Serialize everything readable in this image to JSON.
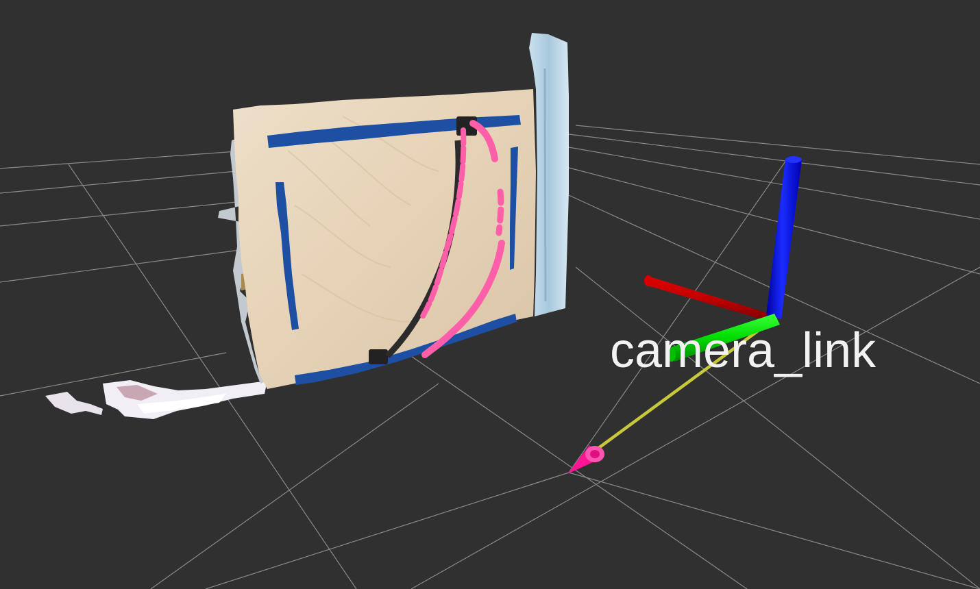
{
  "viewer": {
    "background_color": "#303030",
    "grid_color": "#a0a0a0"
  },
  "tf_frame": {
    "name": "camera_link",
    "axis_colors": {
      "x": "#ff0000",
      "y": "#00ff00",
      "z": "#0000ff"
    },
    "arrow_shaft_color": "#c8c83c",
    "arrow_head_color": "#ff1493"
  },
  "point_cloud": {
    "board_color": "#e6d4bb",
    "rail_color": "#1f4fa8",
    "cable_color": "#ff5fa8",
    "pillar_color": "#b5d4e8"
  }
}
